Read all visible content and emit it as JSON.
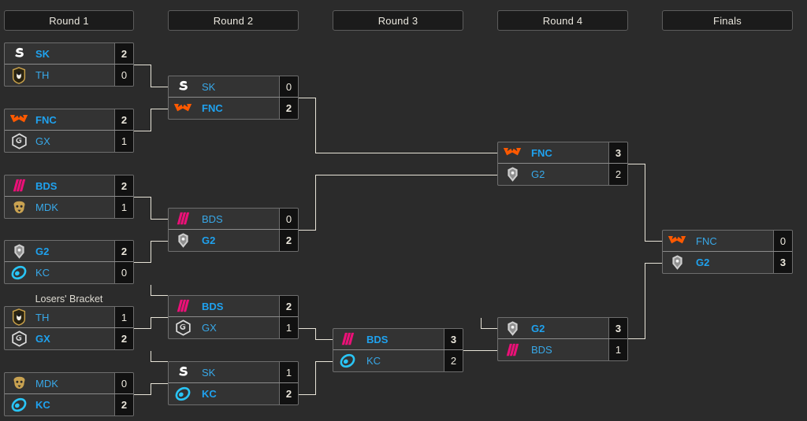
{
  "page": {
    "background": "#2b2b2b",
    "line_color": "#e8e4d8",
    "accent_blue": "#38a8e8",
    "box_bg": "#333333",
    "score_bg": "#111111"
  },
  "headers": [
    {
      "label": "Round 1"
    },
    {
      "label": "Round 2"
    },
    {
      "label": "Round 3"
    },
    {
      "label": "Round 4"
    },
    {
      "label": "Finals"
    }
  ],
  "labels": {
    "losers_bracket": "Losers' Bracket"
  },
  "teams": {
    "SK": {
      "name": "SK",
      "color": "#ffffff"
    },
    "TH": {
      "name": "TH",
      "color": "#c9a14a"
    },
    "FNC": {
      "name": "FNC",
      "color": "#ff5900"
    },
    "GX": {
      "name": "GX",
      "color": "#d8d8d8"
    },
    "BDS": {
      "name": "BDS",
      "color": "#ec1078"
    },
    "MDK": {
      "name": "MDK",
      "color": "#c9a251"
    },
    "G2": {
      "name": "G2",
      "color": "#d9d9d9"
    },
    "KC": {
      "name": "KC",
      "color": "#29c5f6"
    }
  },
  "matches": {
    "wb_r1_m1": {
      "top": {
        "team": "SK",
        "score": "2",
        "winner": true
      },
      "bottom": {
        "team": "TH",
        "score": "0",
        "winner": false
      }
    },
    "wb_r1_m2": {
      "top": {
        "team": "FNC",
        "score": "2",
        "winner": true
      },
      "bottom": {
        "team": "GX",
        "score": "1",
        "winner": false
      }
    },
    "wb_r1_m3": {
      "top": {
        "team": "BDS",
        "score": "2",
        "winner": true
      },
      "bottom": {
        "team": "MDK",
        "score": "1",
        "winner": false
      }
    },
    "wb_r1_m4": {
      "top": {
        "team": "G2",
        "score": "2",
        "winner": true
      },
      "bottom": {
        "team": "KC",
        "score": "0",
        "winner": false
      }
    },
    "wb_r2_m1": {
      "top": {
        "team": "SK",
        "score": "0",
        "winner": false
      },
      "bottom": {
        "team": "FNC",
        "score": "2",
        "winner": true
      }
    },
    "wb_r2_m2": {
      "top": {
        "team": "BDS",
        "score": "0",
        "winner": false
      },
      "bottom": {
        "team": "G2",
        "score": "2",
        "winner": true
      }
    },
    "wb_r3_m1": {
      "top": {
        "team": "FNC",
        "score": "3",
        "winner": true
      },
      "bottom": {
        "team": "G2",
        "score": "2",
        "winner": false
      }
    },
    "lb_r1_m1": {
      "top": {
        "team": "TH",
        "score": "1",
        "winner": false
      },
      "bottom": {
        "team": "GX",
        "score": "2",
        "winner": true
      }
    },
    "lb_r1_m2": {
      "top": {
        "team": "MDK",
        "score": "0",
        "winner": false
      },
      "bottom": {
        "team": "KC",
        "score": "2",
        "winner": true
      }
    },
    "lb_r2_m1": {
      "top": {
        "team": "BDS",
        "score": "2",
        "winner": true
      },
      "bottom": {
        "team": "GX",
        "score": "1",
        "winner": false
      }
    },
    "lb_r2_m2": {
      "top": {
        "team": "SK",
        "score": "1",
        "winner": false
      },
      "bottom": {
        "team": "KC",
        "score": "2",
        "winner": true
      }
    },
    "lb_r3_m1": {
      "top": {
        "team": "BDS",
        "score": "3",
        "winner": true
      },
      "bottom": {
        "team": "KC",
        "score": "2",
        "winner": false
      }
    },
    "lb_r4_m1": {
      "top": {
        "team": "G2",
        "score": "3",
        "winner": true
      },
      "bottom": {
        "team": "BDS",
        "score": "1",
        "winner": false
      }
    },
    "finals_m1": {
      "top": {
        "team": "FNC",
        "score": "0",
        "winner": false
      },
      "bottom": {
        "team": "G2",
        "score": "3",
        "winner": true
      }
    }
  }
}
